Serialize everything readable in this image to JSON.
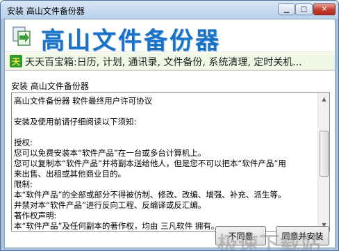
{
  "window": {
    "title": "安装 高山文件备份器",
    "minimize_glyph": "▁",
    "maximize_glyph": "□",
    "close_glyph": "✕"
  },
  "banner": {
    "brand_title": "高山文件备份器",
    "icon": "app-icon"
  },
  "promo": {
    "logo_char": "天",
    "text": "天天百宝箱:日历, 计划, 通讯录, 文件备份, 系统清理, 定时关机..."
  },
  "section_label": "安装 高山文件备份器",
  "license": {
    "lines": [
      "高山文件备份器 软件最终用户许可协议",
      "",
      "安装及使用前请仔细阅读以下须知:",
      "",
      "授权:",
      "您可以免费安装本“软件产品”在一台或多台计算机上。",
      "您可以复制本“软件产品”并将副本送给他人，但是您不可以把本“软件产品”用",
      "来出售、出租或其他商业目的。",
      "限制:",
      "本“软件产品”的全部或部分不得被仿制、修改、改编、增强、补充、派生等。",
      "  并禁对本“软件产品”进行反向工程、反编译或反汇编。",
      "著作权声明:",
      "本“软件产品”及任何副本的著作权，均由 三凡软件 拥有。"
    ]
  },
  "buttons": {
    "disagree": "不同意",
    "agree": "同意并安装"
  },
  "watermark": "极速下载站",
  "colors": {
    "brand": "#1a72c7",
    "title_gradient_top": "#d9e7f5",
    "close_red": "#c2382b"
  }
}
